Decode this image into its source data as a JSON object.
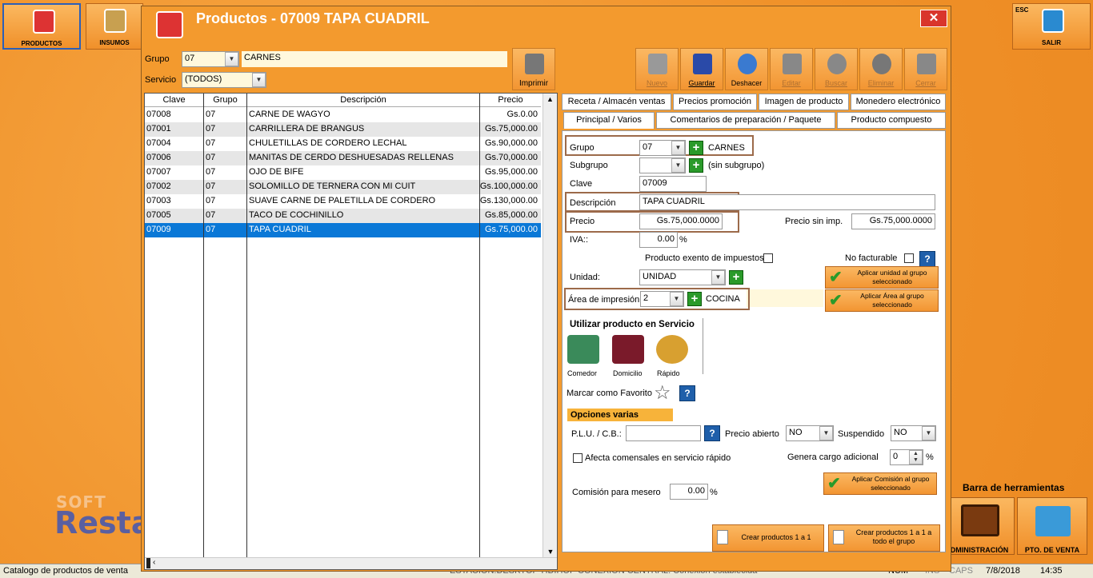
{
  "desktop": {
    "productos_label": "PRODUCTOS",
    "insumos_label": "INSUMOS",
    "salir_label": "SALIR",
    "esc_label": "ESC",
    "logo_top": "SOFT",
    "logo_bottom": "Restau",
    "barra_label": "Barra de herramientas",
    "admin_label": "DMINISTRACIÓN",
    "ptoventa_label": "PTO. DE VENTA"
  },
  "status": {
    "left": "Catalogo de productos de venta",
    "estacion": "ESTACION:DESKTOP-HDIHOP",
    "conexion": "CONEXION CENTRAL:  Conexion establecida",
    "num": "NUM",
    "ins": "INS",
    "caps": "CAPS",
    "date": "7/8/2018",
    "time": "14:35"
  },
  "window": {
    "title": "Productos - 07009   TAPA CUADRIL",
    "close": "✕"
  },
  "filter": {
    "grupo_label": "Grupo",
    "grupo_code": "07",
    "grupo_name": "CARNES",
    "servicio_label": "Servicio",
    "servicio_value": "(TODOS)",
    "imprimir": "Imprimir"
  },
  "toolbar": {
    "nuevo": "Nuevo",
    "guardar": "Guardar",
    "deshacer": "Deshacer",
    "editar": "Editar",
    "buscar": "Buscar",
    "eliminar": "Eliminar",
    "cerrar": "Cerrar"
  },
  "grid": {
    "headers": [
      "Clave",
      "Grupo",
      "Descripción",
      "Precio"
    ],
    "rows": [
      {
        "clave": "07008",
        "grupo": "07",
        "desc": "CARNE DE WAGYO",
        "precio": "Gs.0.00"
      },
      {
        "clave": "07001",
        "grupo": "07",
        "desc": "CARRILLERA DE BRANGUS",
        "precio": "Gs.75,000.00"
      },
      {
        "clave": "07004",
        "grupo": "07",
        "desc": "CHULETILLAS DE CORDERO LECHAL",
        "precio": "Gs.90,000.00"
      },
      {
        "clave": "07006",
        "grupo": "07",
        "desc": "MANITAS DE CERDO DESHUESADAS RELLENAS",
        "precio": "Gs.70,000.00"
      },
      {
        "clave": "07007",
        "grupo": "07",
        "desc": "OJO DE BIFE",
        "precio": "Gs.95,000.00"
      },
      {
        "clave": "07002",
        "grupo": "07",
        "desc": "SOLOMILLO DE TERNERA CON MI CUIT",
        "precio": "Gs.100,000.00"
      },
      {
        "clave": "07003",
        "grupo": "07",
        "desc": "SUAVE CARNE DE PALETILLA DE CORDERO",
        "precio": "Gs.130,000.00"
      },
      {
        "clave": "07005",
        "grupo": "07",
        "desc": "TACO DE COCHINILLO",
        "precio": "Gs.85,000.00"
      },
      {
        "clave": "07009",
        "grupo": "07",
        "desc": "TAPA CUADRIL",
        "precio": "Gs.75,000.00"
      }
    ]
  },
  "tabs": {
    "row1": [
      "Receta / Almacén ventas",
      "Precios promoción",
      "Imagen de producto",
      "Monedero electrónico"
    ],
    "row2": [
      "Principal / Varios",
      "Comentarios de preparación / Paquete",
      "Producto compuesto"
    ]
  },
  "form": {
    "grupo_label": "Grupo",
    "grupo_code": "07",
    "grupo_name": "CARNES",
    "subgrupo_label": "Subgrupo",
    "subgrupo_name": "(sin subgrupo)",
    "clave_label": "Clave",
    "clave_value": "07009",
    "descripcion_label": "Descripción",
    "descripcion_value": "TAPA CUADRIL",
    "precio_label": "Precio",
    "precio_value": "Gs.75,000.0000",
    "precio_sin_imp_label": "Precio sin imp.",
    "precio_sin_imp_value": "Gs.75,000.0000",
    "iva_label": "IVA::",
    "iva_value": "0.00",
    "pct": "%",
    "exento_label": "Producto exento de impuestos",
    "nofact_label": "No facturable",
    "unidad_label": "Unidad:",
    "unidad_value": "UNIDAD",
    "aplicar_unidad": "Aplicar unidad al grupo seleccionado",
    "area_label": "Área de impresión:",
    "area_value": "2",
    "area_name": "COCINA",
    "aplicar_area": "Aplicar Área al grupo seleccionado",
    "utilizar_label": "Utilizar producto en Servicio",
    "comedor": "Comedor",
    "domicilio": "Domicilio",
    "rapido": "Rápido",
    "favorito_label": "Marcar como Favorito",
    "opciones_label": "Opciones varias",
    "plu_label": "P.L.U. / C.B.:",
    "precio_abierto_label": "Precio abierto",
    "precio_abierto_value": "NO",
    "suspendido_label": "Suspendido",
    "suspendido_value": "NO",
    "afecta_label": "Afecta comensales en servicio rápido",
    "genera_label": "Genera cargo adicional",
    "genera_value": "0",
    "aplicar_comision": "Aplicar Comisión al grupo seleccionado",
    "comision_label": "Comisión para mesero",
    "comision_value": "0.00",
    "crear_1a1": "Crear productos 1 a 1",
    "crear_todo": "Crear productos 1 a 1 a todo el grupo"
  },
  "colors": {
    "accent": "#f39a2e",
    "selection": "#0a78d7",
    "highlight_border": "#9c6a4a"
  }
}
